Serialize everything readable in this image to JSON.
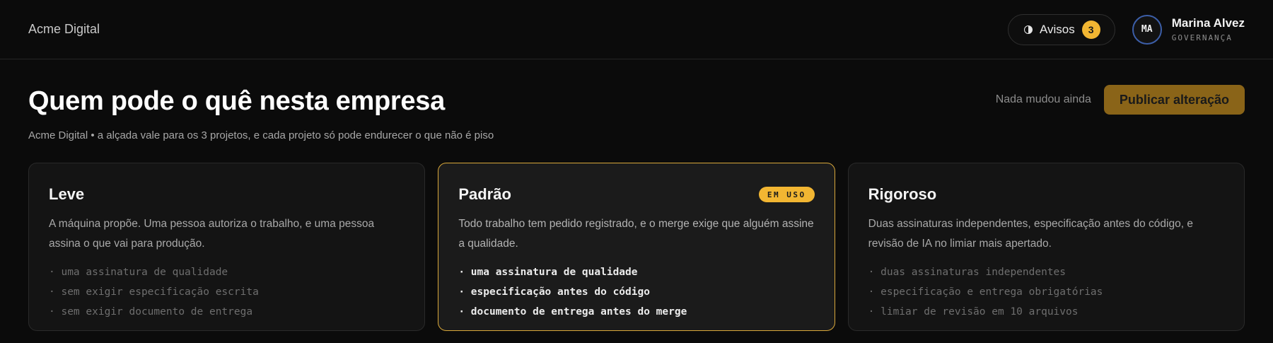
{
  "header": {
    "brand": "Acme Digital",
    "notifications": {
      "label": "Avisos",
      "count": "3",
      "icon": "half-circle-icon"
    },
    "user": {
      "initials": "MA",
      "name": "Marina Alvez",
      "role": "GOVERNANÇA"
    }
  },
  "page": {
    "title": "Quem pode o quê nesta empresa",
    "subtitle": "Acme Digital • a alçada vale para os 3 projetos, e cada projeto só pode endurecer o que não é piso",
    "status": "Nada mudou ainda",
    "publish_label": "Publicar alteração"
  },
  "cards": [
    {
      "title": "Leve",
      "desc": "A máquina propõe. Uma pessoa autoriza o trabalho, e uma pessoa assina o que vai para produção.",
      "rules": [
        "· uma assinatura de qualidade",
        "· sem exigir especificação escrita",
        "· sem exigir documento de entrega"
      ]
    },
    {
      "title": "Padrão",
      "badge": "EM USO",
      "desc": "Todo trabalho tem pedido registrado, e o merge exige que alguém assine a qualidade.",
      "rules": [
        "· uma assinatura de qualidade",
        "· especificação antes do código",
        "· documento de entrega antes do merge"
      ]
    },
    {
      "title": "Rigoroso",
      "desc": "Duas assinaturas independentes, especificação antes do código, e revisão de IA no limiar mais apertado.",
      "rules": [
        "· duas assinaturas independentes",
        "· especificação e entrega obrigatórias",
        "· limiar de revisão em 10 arquivos"
      ]
    }
  ],
  "colors": {
    "accent": "#f2b632",
    "publish_bg": "#8a6418",
    "active_border": "#d9a83a",
    "avatar_ring": "#3c5ea8"
  }
}
